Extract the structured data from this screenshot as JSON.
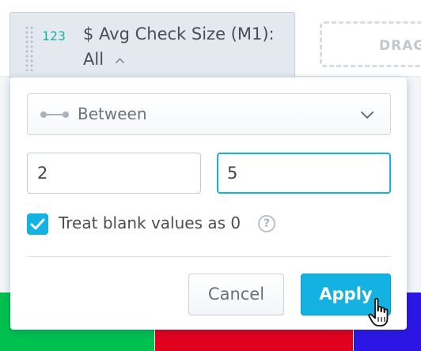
{
  "filter_chip": {
    "metric_icon": "123",
    "title": "$ Avg Check Size (M1):",
    "value": "All",
    "caret_icon": "chevron-up-icon"
  },
  "drag_zone": {
    "label": "DRAG"
  },
  "popup": {
    "operator": {
      "icon": "between-icon",
      "selected": "Between",
      "dropdown_icon": "chevron-down-icon"
    },
    "range": {
      "from_value": "2",
      "to_value": "5"
    },
    "treat_blank": {
      "checked": true,
      "label": "Treat blank values as 0",
      "help_icon": "?"
    },
    "buttons": {
      "cancel_label": "Cancel",
      "apply_label": "Apply"
    }
  },
  "colors": {
    "accent": "#14b2e2",
    "metric_icon": "#14b2a0",
    "band_green": "#00c14f",
    "band_red": "#e1001d",
    "band_blue": "#2b16e5"
  }
}
